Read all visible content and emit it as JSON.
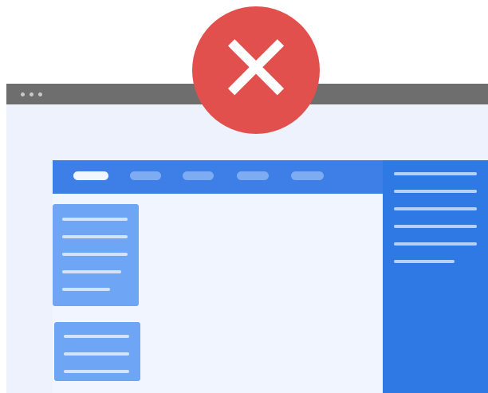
{
  "icons": {
    "error": "close-icon",
    "error_glyph": "✕"
  },
  "colors": {
    "error": "#e2504e",
    "primary": "#3d7fe6",
    "sidebar": "#2f79e4",
    "title_bar": "#6e6e6e",
    "card": "#6ea5f5",
    "background": "#eef3fd"
  }
}
